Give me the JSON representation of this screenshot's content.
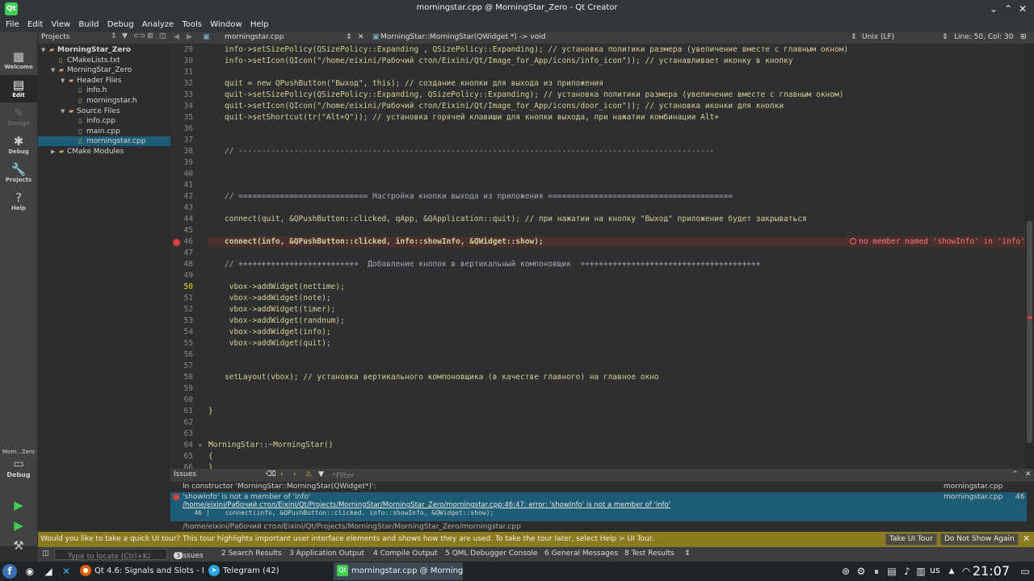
{
  "window": {
    "title": "morningstar.cpp @ MorningStar_Zero - Qt Creator"
  },
  "menu": [
    "File",
    "Edit",
    "View",
    "Build",
    "Debug",
    "Analyze",
    "Tools",
    "Window",
    "Help"
  ],
  "modes": [
    {
      "label": "Welcome",
      "icon": "welcome-icon",
      "glyph": "▦"
    },
    {
      "label": "Edit",
      "icon": "edit-icon",
      "glyph": "▤",
      "active": true
    },
    {
      "label": "Design",
      "icon": "design-icon",
      "glyph": "✎",
      "disabled": true
    },
    {
      "label": "Debug",
      "icon": "debug-icon",
      "glyph": "✱"
    },
    {
      "label": "Projects",
      "icon": "projects-icon",
      "glyph": "🔧"
    },
    {
      "label": "Help",
      "icon": "help-icon",
      "glyph": "?"
    }
  ],
  "target": {
    "name": "Mom...Zero",
    "mode": "Debug"
  },
  "sidebar": {
    "title": "Projects",
    "tree": [
      {
        "label": "MorningStar_Zero",
        "depth": 0,
        "arrow": "▼",
        "bold": true
      },
      {
        "label": "CMakeLists.txt",
        "depth": 1
      },
      {
        "label": "MorningStar_Zero",
        "depth": 1,
        "arrow": "▼"
      },
      {
        "label": "Header Files",
        "depth": 2,
        "arrow": "▼"
      },
      {
        "label": "info.h",
        "depth": 3
      },
      {
        "label": "morningstar.h",
        "depth": 3
      },
      {
        "label": "Source Files",
        "depth": 2,
        "arrow": "▼"
      },
      {
        "label": "info.cpp",
        "depth": 3
      },
      {
        "label": "main.cpp",
        "depth": 3
      },
      {
        "label": "morningstar.cpp",
        "depth": 3,
        "selected": true
      },
      {
        "label": "CMake Modules",
        "depth": 1,
        "arrow": "▶"
      }
    ]
  },
  "editor_header": {
    "file": "morningstar.cpp",
    "symbol": "MorningStar::MorningStar(QWidget *) -> void",
    "line_ending": "Unix (LF)",
    "position": "Line: 50, Col: 30"
  },
  "code": [
    {
      "n": "29",
      "t": "info->setSizePolicy(QSizePolicy::Expanding , QSizePolicy::Expanding); // установка политики размера (увеличение вместе с главным окном)"
    },
    {
      "n": "30",
      "t": "info->setIcon(QIcon(\"/home/eixini/Рабочий стол/Eixini/Qt/Image_for_App/icons/info_icon\")); // устанавливает иконку в кнопку"
    },
    {
      "n": "31",
      "t": ""
    },
    {
      "n": "32",
      "t": "quit = new QPushButton(\"Выход\", this); // создание кнопки для выхода из приложения"
    },
    {
      "n": "33",
      "t": "quit->setSizePolicy(QSizePolicy::Expanding, QSizePolicy::Expanding); // установка политики размера (увеличение вместе с главным окном)"
    },
    {
      "n": "34",
      "t": "quit->setIcon(QIcon(\"/home/eixini/Рабочий стол/Eixini/Qt/Image_for_App/icons/door_icon\")); // установка иконки для кнопки"
    },
    {
      "n": "35",
      "t": "quit->setShortcut(tr(\"Alt+Q\")); // установка горячей клавиши для кнопки выхода, при нажатии комбинации Alt+"
    },
    {
      "n": "36",
      "t": ""
    },
    {
      "n": "37",
      "t": ""
    },
    {
      "n": "38",
      "t": "// -------------------------------------------------------------------------------------------------------"
    },
    {
      "n": "39",
      "t": ""
    },
    {
      "n": "40",
      "t": ""
    },
    {
      "n": "41",
      "t": ""
    },
    {
      "n": "42",
      "t": "// ============================ Настройка кнопки выхода из приложения ========================================"
    },
    {
      "n": "43",
      "t": ""
    },
    {
      "n": "44",
      "t": "connect(quit, &QPushButton::clicked, qApp, &QApplication::quit); // при нажатии на кнопку \"Выход\" приложение будет закрываться"
    },
    {
      "n": "45",
      "t": ""
    },
    {
      "n": "46",
      "t": "connect(info, &QPushButton::clicked, info::showInfo, &QWidget::show);",
      "error": true
    },
    {
      "n": "47",
      "t": ""
    },
    {
      "n": "48",
      "t": "// ++++++++++++++++++++++++++  Добавление кнопок в вертикальный компоновщик  +++++++++++++++++++++++++++++++++++++++"
    },
    {
      "n": "49",
      "t": ""
    },
    {
      "n": "50",
      "t": " vbox->addWidget(nettime);",
      "current": true
    },
    {
      "n": "51",
      "t": " vbox->addWidget(note);"
    },
    {
      "n": "52",
      "t": " vbox->addWidget(timer);"
    },
    {
      "n": "53",
      "t": " vbox->addWidget(randnum);"
    },
    {
      "n": "54",
      "t": " vbox->addWidget(info);"
    },
    {
      "n": "55",
      "t": " vbox->addWidget(quit);"
    },
    {
      "n": "56",
      "t": ""
    },
    {
      "n": "57",
      "t": ""
    },
    {
      "n": "58",
      "t": "setLayout(vbox); // установка вертикального компоновщика (в качестве главного) на главное окно"
    },
    {
      "n": "59",
      "t": ""
    },
    {
      "n": "60",
      "t": ""
    },
    {
      "n": "61",
      "t": "}",
      "outdent": true
    },
    {
      "n": "62",
      "t": ""
    },
    {
      "n": "63",
      "t": ""
    },
    {
      "n": "64",
      "t": "MorningStar::~MorningStar()",
      "outdent": true
    },
    {
      "n": "65",
      "t": "{",
      "outdent": true
    },
    {
      "n": "66",
      "t": "}",
      "outdent": true
    }
  ],
  "inline_error": "no member named 'showInfo' in 'info'",
  "issues": {
    "title": "Issues",
    "filter_placeholder": "Filter",
    "rows": [
      {
        "text": "In constructor 'MorningStar::MorningStar(QWidget*)':",
        "file": "morningstar.cpp",
        "line": ""
      },
      {
        "text": "'showInfo' is not a member of 'info'",
        "file": "morningstar.cpp",
        "line": "46"
      },
      {
        "text": "/home/eixini/Рабочий стол/Eixini/Qt/Projects/MorningStar/MorningStar_Zero/morningstar.cpp:46:47: error: 'showInfo' is not a member of 'info'"
      },
      {
        "text": "   46 |    connect(info, &QPushButton::clicked, info::showInfo, &QWidget::show);"
      },
      {
        "text": "/home/eixini/Рабочий стол/Eixini/Qt/Projects/MorningStar/MorningStar_Zero/morningstar.cpp"
      }
    ]
  },
  "tour": {
    "text": "Would you like to take a quick UI tour? This tour highlights important user interface elements and shows how they are used. To take the tour later, select Help > UI Tour.",
    "take": "Take UI Tour",
    "dismiss": "Do Not Show Again"
  },
  "output_tabs": {
    "locate_placeholder": "Type to locate (Ctrl+K)",
    "tabs": [
      "1  Issues",
      "2  Search Results",
      "3  Application Output",
      "4  Compile Output",
      "5  QML Debugger Console",
      "6  General Messages",
      "8  Test Results"
    ],
    "issues_count": "3"
  },
  "taskbar": {
    "tasks": [
      {
        "label": "Qt 4.6: Signals and Slots - M...",
        "icon": "firefox-icon",
        "color": "#e66000"
      },
      {
        "label": "Telegram (42)",
        "icon": "telegram-icon",
        "color": "#2ca5e0"
      },
      {
        "label": "morningstar.cpp @ MorningS...",
        "icon": "qtcreator-icon",
        "color": "#41cd52",
        "active": true
      }
    ],
    "keyboard": "us",
    "clock": "21:07"
  }
}
